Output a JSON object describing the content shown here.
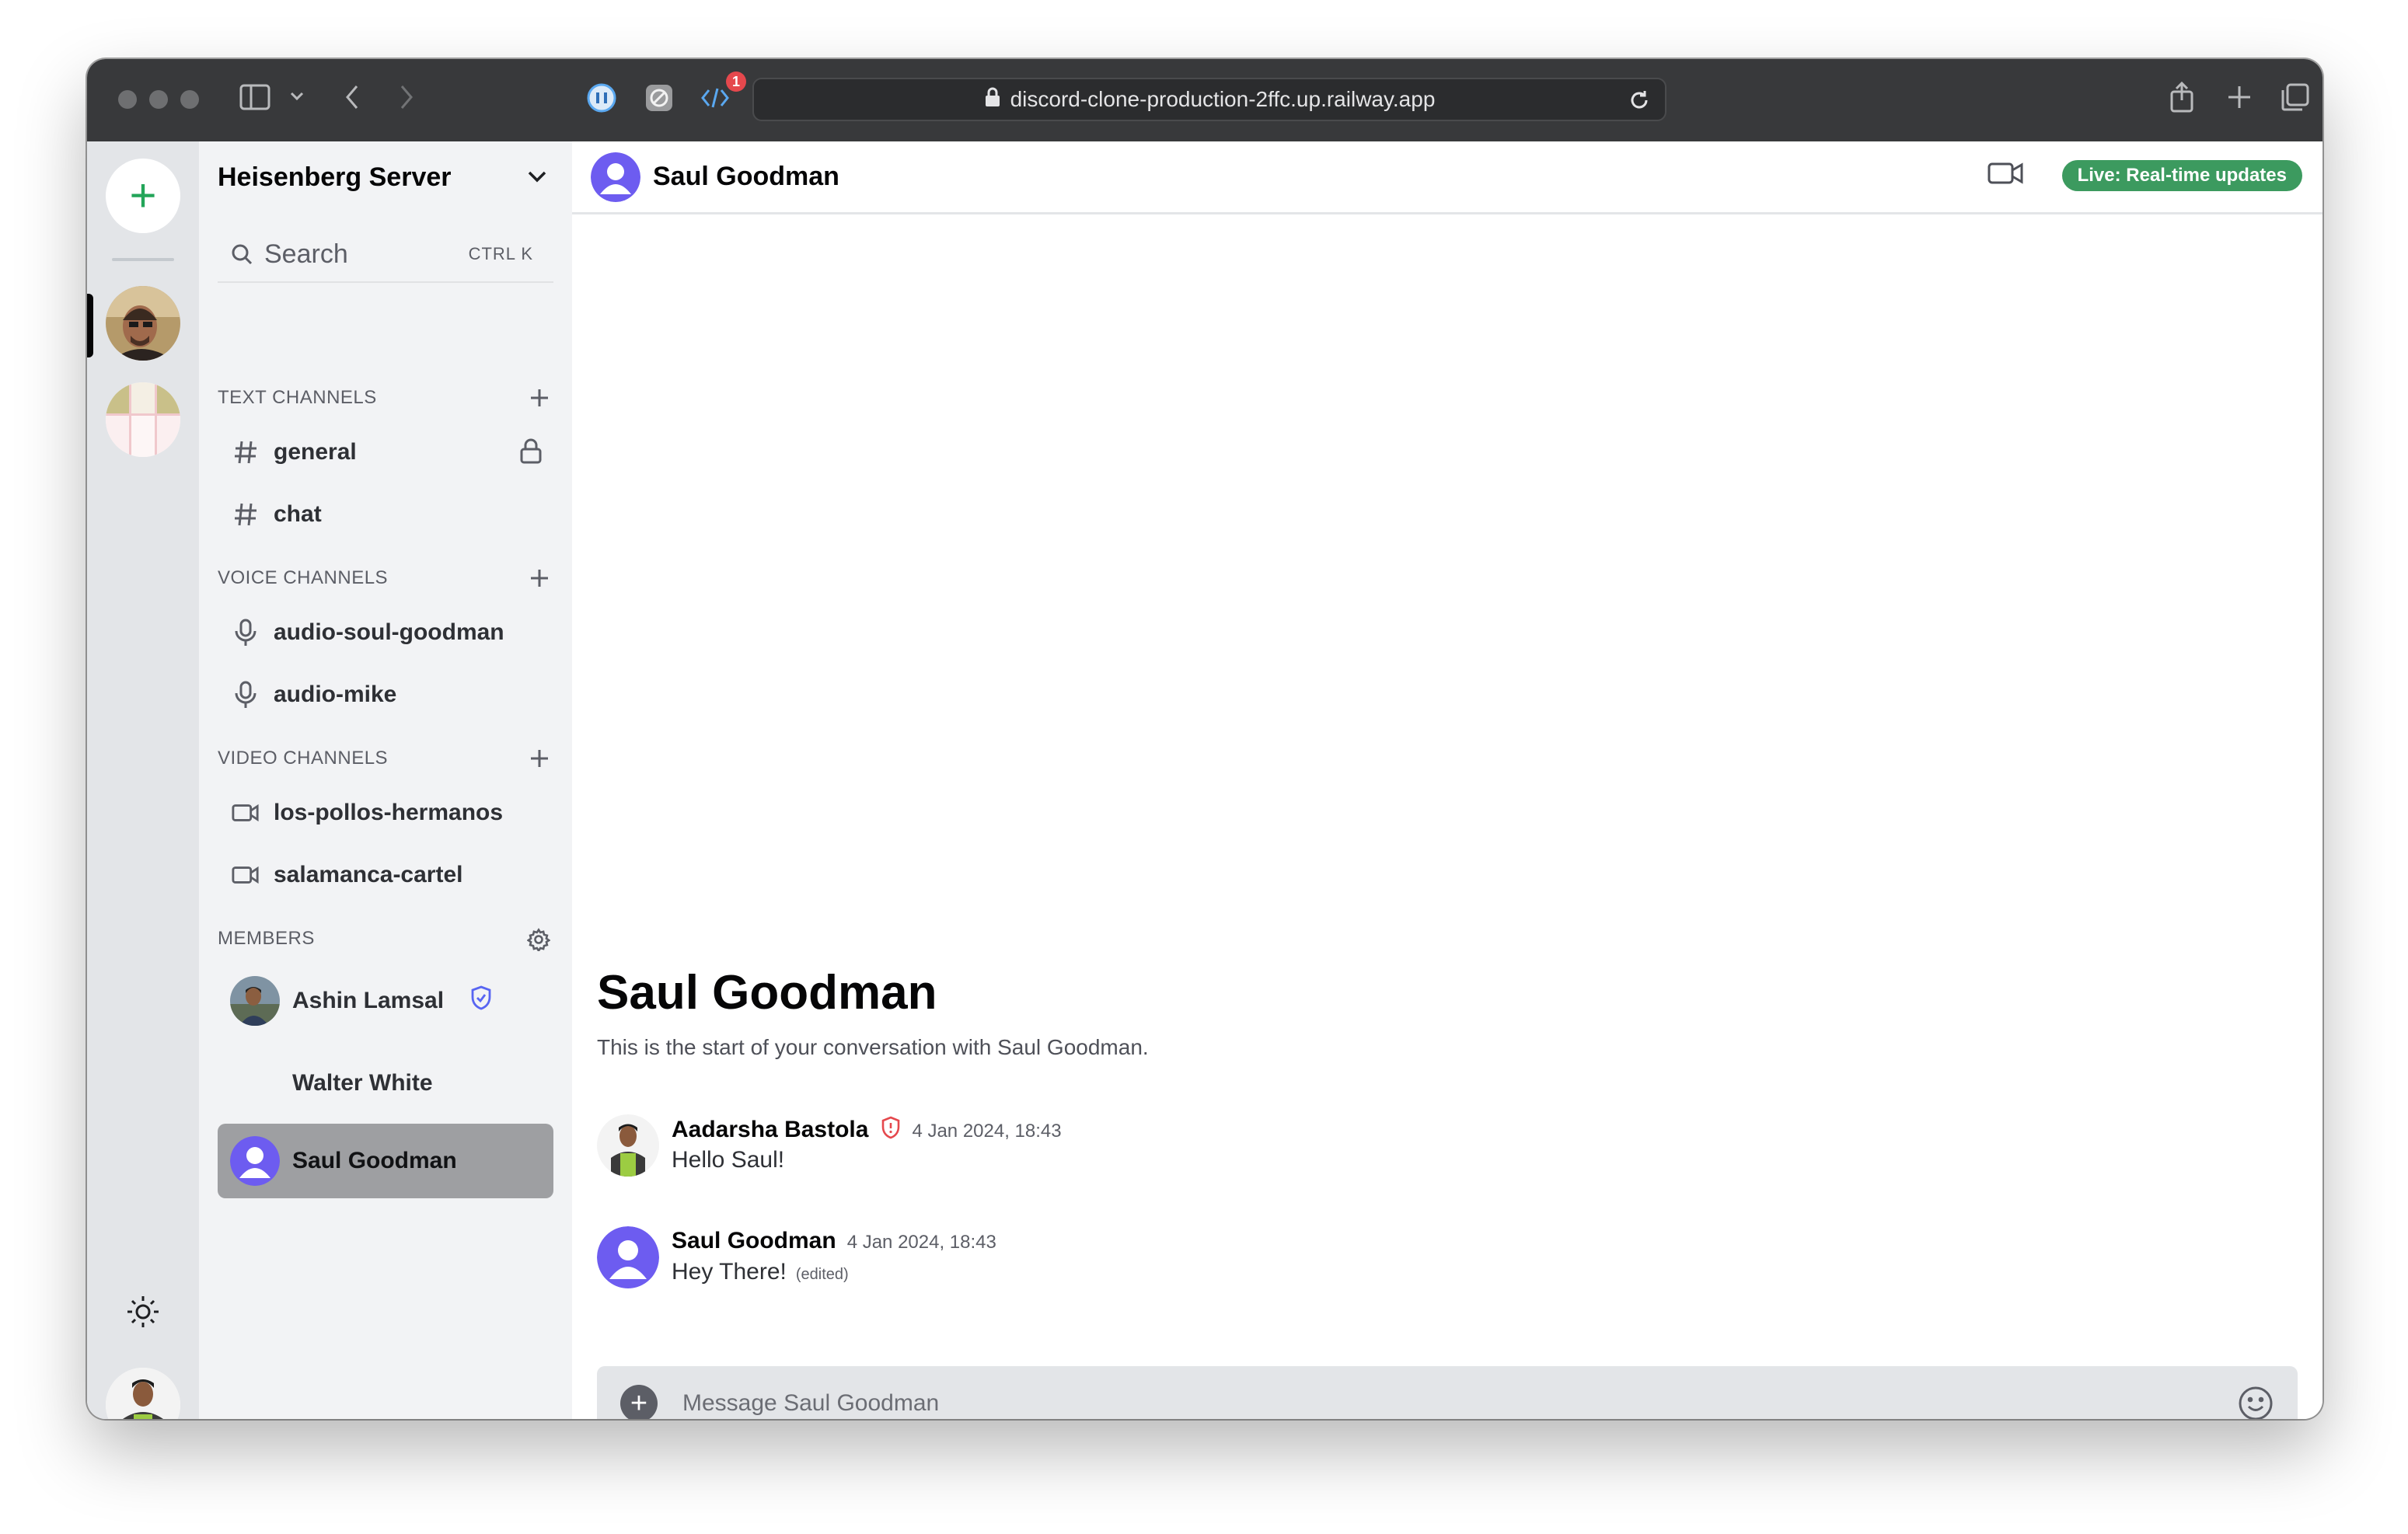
{
  "browser": {
    "url": "discord-clone-production-2ffc.up.railway.app",
    "extension_badge": "1"
  },
  "rail": {
    "add_server_label": "+"
  },
  "server": {
    "name": "Heisenberg Server",
    "search_placeholder": "Search",
    "search_shortcut": "CTRL K"
  },
  "sections": {
    "text": "TEXT CHANNELS",
    "voice": "VOICE CHANNELS",
    "video": "VIDEO CHANNELS",
    "members": "MEMBERS"
  },
  "text_channels": [
    {
      "name": "general",
      "locked": true
    },
    {
      "name": "chat",
      "locked": false
    }
  ],
  "voice_channels": [
    {
      "name": "audio-soul-goodman"
    },
    {
      "name": "audio-mike"
    }
  ],
  "video_channels": [
    {
      "name": "los-pollos-hermanos"
    },
    {
      "name": "salamanca-cartel"
    }
  ],
  "members": [
    {
      "name": "Ashin Lamsal",
      "role_icon": "shield-check-icon"
    },
    {
      "name": "Walter White"
    },
    {
      "name": "Saul Goodman",
      "active": true
    }
  ],
  "chat": {
    "header_title": "Saul Goodman",
    "live_badge": "Live: Real-time updates",
    "welcome_title": "Saul Goodman",
    "welcome_subtitle": "This is the start of your conversation with Saul Goodman.",
    "composer_placeholder": "Message Saul Goodman"
  },
  "messages": [
    {
      "author": "Aadarsha Bastola",
      "role_icon": "shield-alert-icon",
      "time": "4 Jan 2024, 18:43",
      "text": "Hello Saul!"
    },
    {
      "author": "Saul Goodman",
      "time": "4 Jan 2024, 18:43",
      "text": "Hey There!",
      "edited": "(edited)"
    }
  ],
  "colors": {
    "accent_green": "#23a559",
    "live_badge_bg": "#3c9a5f",
    "avatar_purple": "#6d5cf0",
    "admin_red": "#e5484d",
    "mod_blue": "#5865f2"
  }
}
